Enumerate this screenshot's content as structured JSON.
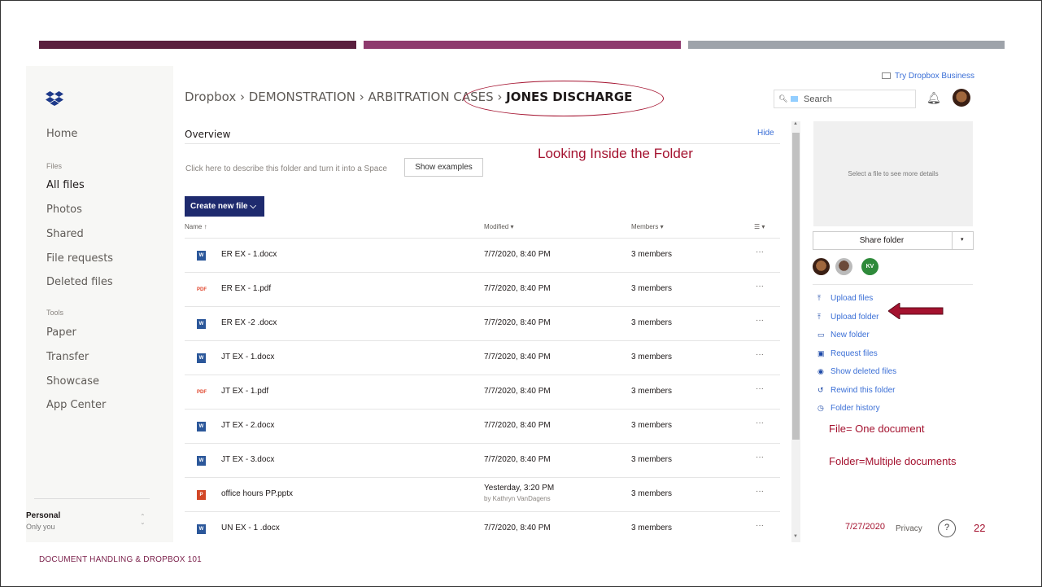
{
  "breadcrumb": {
    "prefix": "Dropbox › DEMONSTRATION › ARBITRATION CASES › ",
    "current": "JONES DISCHARGE"
  },
  "header": {
    "try_business": "Try Dropbox Business",
    "search_placeholder": "Search"
  },
  "sidebar": {
    "home": "Home",
    "files_section": "Files",
    "all_files": "All files",
    "photos": "Photos",
    "shared": "Shared",
    "file_requests": "File requests",
    "deleted_files": "Deleted files",
    "tools_section": "Tools",
    "paper": "Paper",
    "transfer": "Transfer",
    "showcase": "Showcase",
    "app_center": "App Center",
    "personal": "Personal",
    "only_you": "Only you"
  },
  "overview": {
    "title": "Overview",
    "hide": "Hide",
    "description": "Click here to describe this folder and turn it into a Space",
    "show_examples": "Show examples",
    "create_new_file": "Create new file ⌵"
  },
  "annotation": "Looking Inside the Folder",
  "table": {
    "col_name": "Name ↑",
    "col_modified": "Modified ▾",
    "col_members": "Members ▾",
    "col_view": "☰ ▾",
    "rows": [
      {
        "icon": "W",
        "type": "word",
        "name": "ER EX - 1.docx",
        "modified": "7/7/2020, 8:40 PM",
        "by": "",
        "members": "3 members",
        "more": "···"
      },
      {
        "icon": "PDF",
        "type": "pdf",
        "name": "ER EX - 1.pdf",
        "modified": "7/7/2020, 8:40 PM",
        "by": "",
        "members": "3 members",
        "more": "···"
      },
      {
        "icon": "W",
        "type": "word",
        "name": "ER EX -2 .docx",
        "modified": "7/7/2020, 8:40 PM",
        "by": "",
        "members": "3 members",
        "more": "···"
      },
      {
        "icon": "W",
        "type": "word",
        "name": "JT EX - 1.docx",
        "modified": "7/7/2020, 8:40 PM",
        "by": "",
        "members": "3 members",
        "more": "···"
      },
      {
        "icon": "PDF",
        "type": "pdf",
        "name": "JT EX - 1.pdf",
        "modified": "7/7/2020, 8:40 PM",
        "by": "",
        "members": "3 members",
        "more": "···"
      },
      {
        "icon": "W",
        "type": "word",
        "name": "JT EX - 2.docx",
        "modified": "7/7/2020, 8:40 PM",
        "by": "",
        "members": "3 members",
        "more": "···"
      },
      {
        "icon": "W",
        "type": "word",
        "name": "JT EX - 3.docx",
        "modified": "7/7/2020, 8:40 PM",
        "by": "",
        "members": "3 members",
        "more": "···"
      },
      {
        "icon": "P",
        "type": "ppt",
        "name": "office hours PP.pptx",
        "modified": "Yesterday, 3:20 PM",
        "by": "by Kathryn VanDagens",
        "members": "3 members",
        "more": "···"
      },
      {
        "icon": "W",
        "type": "word",
        "name": "UN EX - 1 .docx",
        "modified": "7/7/2020, 8:40 PM",
        "by": "",
        "members": "3 members",
        "more": "···"
      }
    ]
  },
  "right_panel": {
    "details": "Select a file to see more details",
    "share_folder": "Share folder",
    "member_initials": "KV",
    "actions": {
      "upload_files": "Upload files",
      "upload_folder": "Upload folder",
      "new_folder": "New folder",
      "request_files": "Request files",
      "show_deleted": "Show deleted files",
      "rewind": "Rewind this folder",
      "history": "Folder history"
    },
    "note_file": "File= One document",
    "note_folder": "Folder=Multiple documents"
  },
  "footer": {
    "date": "7/27/2020",
    "privacy": "Privacy",
    "help": "?",
    "page_number": "22",
    "slide_footer": "DOCUMENT HANDLING & DROPBOX 101"
  },
  "colors": {
    "accent_red": "#a4122f",
    "link_blue": "#3b6fd6",
    "create_button": "#1e2a6e",
    "bar_plum": "#5a1f3e",
    "bar_magenta": "#8e3a6e",
    "bar_gray": "#9ea3aa"
  }
}
